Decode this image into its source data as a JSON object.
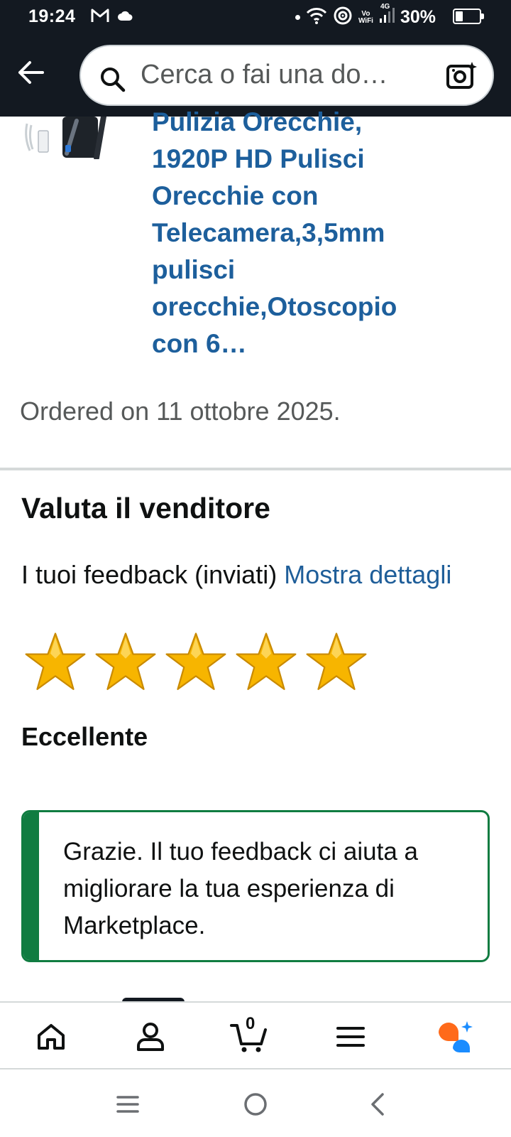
{
  "status_bar": {
    "time": "19:24",
    "vo_label": "Vo",
    "wifi_label": "WiFi",
    "network": "4G",
    "battery_percent": "30%",
    "battery_level": 0.3
  },
  "header": {
    "search_placeholder": "Cerca o fai una do…"
  },
  "product": {
    "title": "Pulizia Orecchie, 1920P HD Pulisci Orecchie con Telecamera,3,5mm pulisci orecchie,Otoscopio con 6…"
  },
  "order": {
    "date_text": "Ordered on 11 ottobre 2025."
  },
  "seller_rating": {
    "title": "Valuta il venditore",
    "feedback_text": "I tuoi feedback (inviati)",
    "feedback_link": "Mostra dettagli",
    "stars": 5,
    "max_stars": 5,
    "rating_label": "Eccellente"
  },
  "alert": {
    "message": "Grazie. Il tuo feedback ci aiuta a migliorare la tua esperienza di Marketplace."
  },
  "bottom_nav": {
    "items": [
      "home-icon",
      "account-icon",
      "cart-icon",
      "menu-icon",
      "rufus-icon"
    ],
    "cart_count": "0",
    "active": "account-icon"
  },
  "colors": {
    "header_bg": "#131921",
    "link": "#1d5f9c",
    "success": "#107c41",
    "star": "#f7b500",
    "rufus_orange": "#ff6a1a",
    "rufus_blue": "#1a8cff"
  }
}
